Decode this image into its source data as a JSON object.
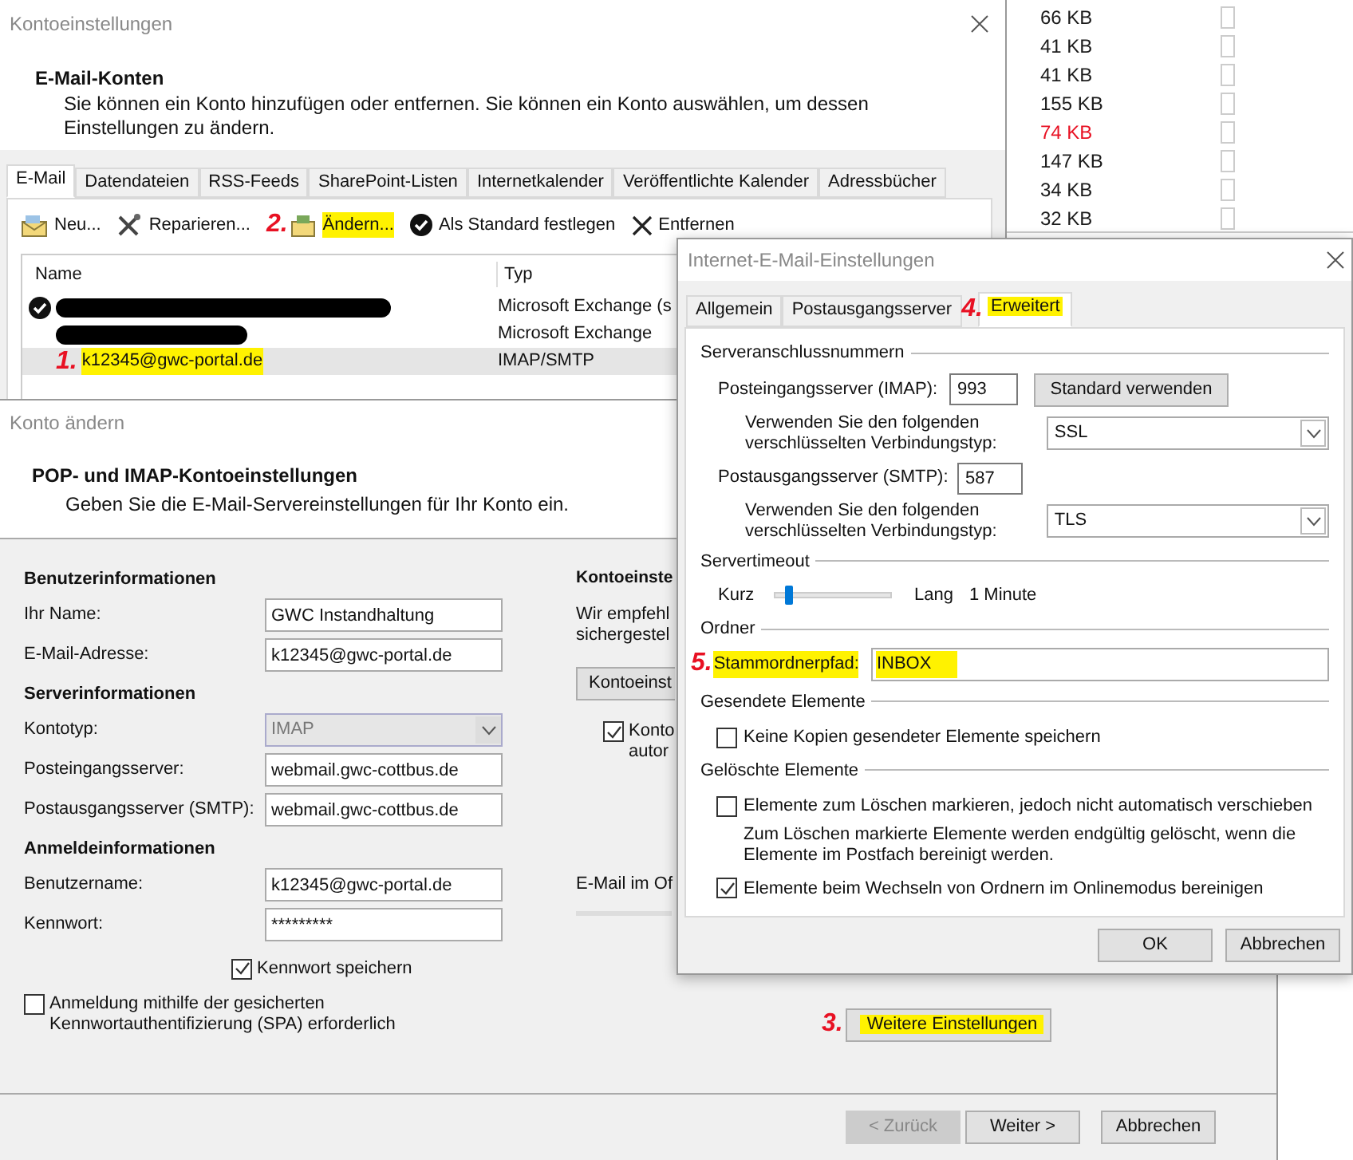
{
  "background_list": {
    "rows": [
      {
        "size": "66 KB",
        "color": "#1a1a1a",
        "checked": false
      },
      {
        "size": "41 KB",
        "color": "#1a1a1a",
        "checked": false
      },
      {
        "size": "41 KB",
        "color": "#1a1a1a",
        "checked": false
      },
      {
        "size": "155 KB",
        "color": "#1a1a1a",
        "checked": false
      },
      {
        "size": "74 KB",
        "color": "#e81123",
        "checked": false
      },
      {
        "size": "147 KB",
        "color": "#1a1a1a",
        "checked": false
      },
      {
        "size": "34 KB",
        "color": "#1a1a1a",
        "checked": false
      },
      {
        "size": "32 KB",
        "color": "#1a1a1a",
        "checked": false
      }
    ]
  },
  "account_settings": {
    "title": "Kontoeinstellungen",
    "heading": "E-Mail-Konten",
    "description": "Sie können ein Konto hinzufügen oder entfernen. Sie können ein Konto auswählen, um dessen Einstellungen zu ändern.",
    "tabs": [
      {
        "label": "E-Mail",
        "selected": true
      },
      {
        "label": "Datendateien",
        "selected": false
      },
      {
        "label": "RSS-Feeds",
        "selected": false
      },
      {
        "label": "SharePoint-Listen",
        "selected": false
      },
      {
        "label": "Internetkalender",
        "selected": false
      },
      {
        "label": "Veröffentlichte Kalender",
        "selected": false
      },
      {
        "label": "Adressbücher",
        "selected": false
      }
    ],
    "toolbar": [
      {
        "kind": "new",
        "label": "Neu...",
        "highlighted": false
      },
      {
        "kind": "repair",
        "label": "Reparieren...",
        "highlighted": false
      },
      {
        "kind": "change",
        "label": "Ändern...",
        "highlighted": true,
        "step": "2."
      },
      {
        "kind": "default",
        "label": "Als Standard festlegen",
        "highlighted": false
      },
      {
        "kind": "remove",
        "label": "Entfernen",
        "highlighted": false
      }
    ],
    "columns": [
      "Name",
      "Typ"
    ],
    "rows": [
      {
        "kind": "redacted",
        "default": true,
        "type": "Microsoft Exchange (s",
        "selected": false
      },
      {
        "kind": "redacted",
        "default": false,
        "type": "Microsoft Exchange",
        "selected": false
      },
      {
        "kind": "text",
        "default": false,
        "name": "k12345@gwc-portal.de",
        "type": "IMAP/SMTP",
        "selected": true,
        "highlighted": true,
        "step": "1."
      }
    ]
  },
  "change_account": {
    "title": "Konto ändern",
    "heading": "POP- und IMAP-Kontoeinstellungen",
    "subheading": "Geben Sie die E-Mail-Servereinstellungen für Ihr Konto ein.",
    "sections": [
      {
        "title": "Benutzerinformationen",
        "fields": [
          {
            "kind": "input",
            "label": "Ihr Name:",
            "value": "GWC Instandhaltung"
          },
          {
            "kind": "input",
            "label": "E-Mail-Adresse:",
            "value": "k12345@gwc-portal.de"
          }
        ]
      },
      {
        "title": "Serverinformationen",
        "fields": [
          {
            "kind": "select",
            "label": "Kontotyp:",
            "value": "IMAP",
            "disabled": true
          },
          {
            "kind": "input",
            "label": "Posteingangsserver:",
            "value": "webmail.gwc-cottbus.de"
          },
          {
            "kind": "input",
            "label": "Postausgangsserver (SMTP):",
            "value": "webmail.gwc-cottbus.de"
          }
        ]
      },
      {
        "title": "Anmeldeinformationen",
        "fields": [
          {
            "kind": "input",
            "label": "Benutzername:",
            "value": "k12345@gwc-portal.de"
          },
          {
            "kind": "input",
            "label": "Kennwort:",
            "value": "*********"
          }
        ]
      }
    ],
    "remember_password": {
      "label": "Kennwort speichern",
      "checked": true
    },
    "spa": {
      "label": "Anmeldung mithilfe der gesicherten Kennwortauthentifizierung (SPA) erforderlich",
      "checked": false
    },
    "right": {
      "heading": "Kontoeinste",
      "text_lines": [
        "Wir empfehl",
        "sichergestel"
      ],
      "button": "Kontoeinst",
      "checkbox": {
        "lines": [
          "Konto",
          "autor"
        ],
        "checked": true
      },
      "offline_label": "E-Mail im Of"
    },
    "more_settings": {
      "label": "Weitere Einstellungen",
      "highlighted": true,
      "step": "3."
    },
    "buttons": [
      {
        "label": "< Zurück",
        "disabled": true
      },
      {
        "label": "Weiter >",
        "disabled": false
      },
      {
        "label": "Abbrechen",
        "disabled": false
      }
    ]
  },
  "internet_settings": {
    "title": "Internet-E-Mail-Einstellungen",
    "tabs": [
      {
        "label": "Allgemein",
        "selected": false,
        "highlighted": false
      },
      {
        "label": "Postausgangsserver",
        "selected": false,
        "highlighted": false
      },
      {
        "label": "Erweitert",
        "selected": true,
        "highlighted": true,
        "step": "4."
      }
    ],
    "ports": {
      "title": "Serveranschlussnummern",
      "incoming_label": "Posteingangsserver (IMAP):",
      "incoming_value": "993",
      "default_button": "Standard verwenden",
      "enc_label_1": "Verwenden Sie den folgenden verschlüsselten Verbindungstyp:",
      "incoming_encryption": "SSL",
      "outgoing_label": "Postausgangsserver (SMTP):",
      "outgoing_value": "587",
      "enc_label_2": "Verwenden Sie den folgenden verschlüsselten Verbindungstyp:",
      "outgoing_encryption": "TLS"
    },
    "timeout": {
      "title": "Servertimeout",
      "short": "Kurz",
      "long": "Lang",
      "level": 0.08,
      "reading": "1 Minute"
    },
    "folders": {
      "title": "Ordner",
      "label": "Stammordnerpfad:",
      "value": "INBOX",
      "highlighted": true,
      "step": "5."
    },
    "sent": {
      "title": "Gesendete Elemente",
      "options": [
        {
          "label": "Keine Kopien gesendeter Elemente speichern",
          "checked": false
        }
      ]
    },
    "deleted": {
      "title": "Gelöschte Elemente",
      "options": [
        {
          "label": "Elemente zum Löschen markieren, jedoch nicht automatisch verschieben",
          "checked": false,
          "note": "Zum Löschen markierte Elemente werden endgültig gelöscht, wenn die Elemente im Postfach bereinigt werden."
        },
        {
          "label": "Elemente beim Wechseln von Ordnern im Onlinemodus bereinigen",
          "checked": true
        }
      ]
    },
    "buttons": [
      "OK",
      "Abbrechen"
    ]
  }
}
